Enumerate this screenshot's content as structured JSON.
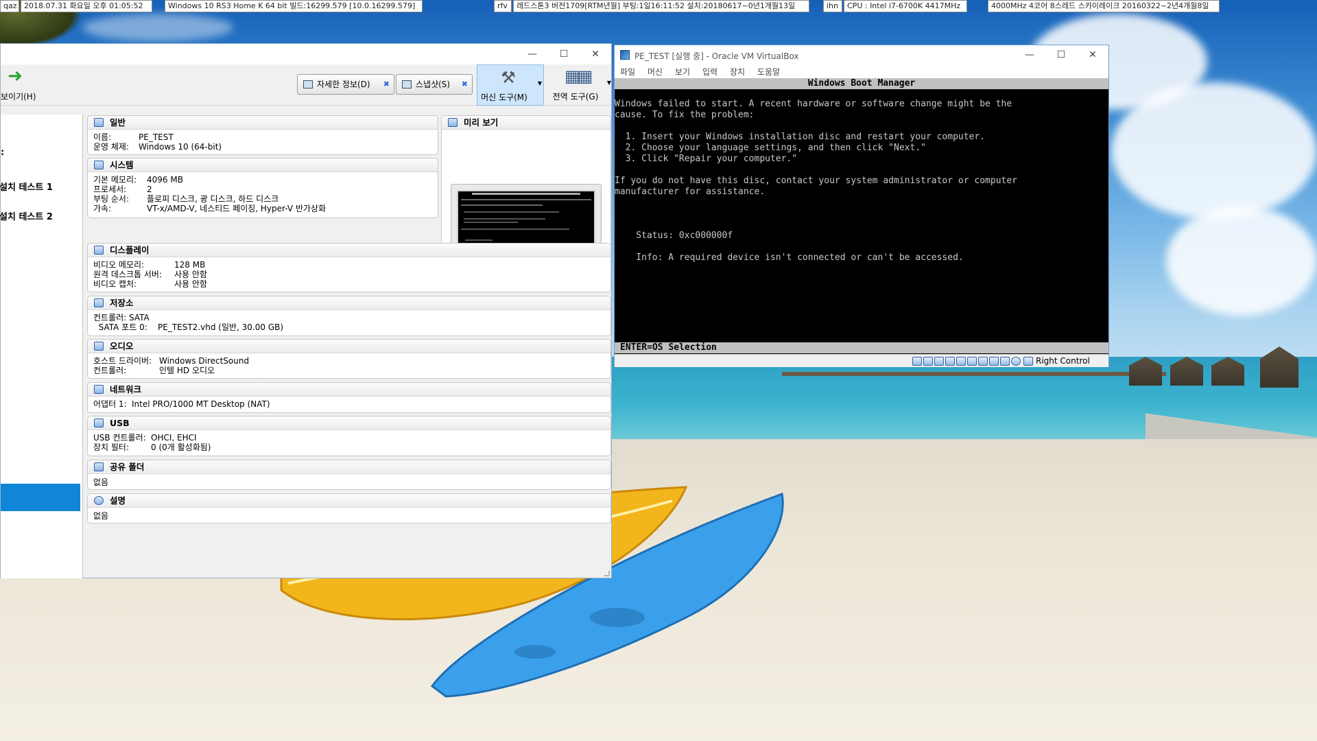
{
  "taskbar": {
    "items": [
      {
        "label": "qaz"
      },
      {
        "label": "2018.07.31 화요일 오후 01:05:52"
      },
      {
        "label": "Windows 10 RS3 Home K 64 bit 빌드:16299.579 [10.0.16299.579]"
      },
      {
        "label": "rfv"
      },
      {
        "label": "레드스톤3 버전1709[RTM년월] 부팅:1일16:11:52 설치:20180617~0년1개월13일"
      },
      {
        "label": "ihn"
      },
      {
        "label": "CPU : Intel i7-6700K 4417MHz"
      },
      {
        "label": "4000MHz 4코어 8스레드 스카이레이크 20160322~2년4개월8일"
      }
    ]
  },
  "manager": {
    "toolbar": {
      "show_label": "보이기(H)",
      "details_label": "자세한 정보(D)",
      "snapshots_label": "스냅샷(S)",
      "machine_tools_label": "머신 도구(M)",
      "global_tools_label": "전역 도구(G)"
    },
    "sidebar": {
      "items": [
        {
          "label": "설치 테스트 1"
        },
        {
          "label": "설치 테스트 2"
        }
      ]
    },
    "sections": {
      "general": {
        "title": "일반",
        "rows": [
          {
            "key": "이름:",
            "value": "PE_TEST"
          },
          {
            "key": "운영 체제:",
            "value": "Windows 10 (64-bit)"
          }
        ]
      },
      "system": {
        "title": "시스템",
        "rows": [
          {
            "key": "기본 메모리:",
            "value": "4096 MB"
          },
          {
            "key": "프로세서:",
            "value": "2"
          },
          {
            "key": "부팅 순서:",
            "value": "플로피 디스크, 광 디스크, 하드 디스크"
          },
          {
            "key": "가속:",
            "value": "VT-x/AMD-V, 네스티드 페이징, Hyper-V 반가상화"
          }
        ]
      },
      "preview": {
        "title": "미리 보기"
      },
      "display": {
        "title": "디스플레이",
        "rows": [
          {
            "key": "비디오 메모리:",
            "value": "128 MB"
          },
          {
            "key": "원격 데스크톱 서버:",
            "value": "사용 안함"
          },
          {
            "key": "비디오 캡처:",
            "value": "사용 안함"
          }
        ]
      },
      "storage": {
        "title": "저장소",
        "rows": [
          {
            "key": "컨트롤러: SATA",
            "value": ""
          },
          {
            "key": "  SATA 포트 0:",
            "value": "PE_TEST2.vhd (일반, 30.00 GB)"
          }
        ]
      },
      "audio": {
        "title": "오디오",
        "rows": [
          {
            "key": "호스트 드라이버:",
            "value": "Windows DirectSound"
          },
          {
            "key": "컨트롤러:",
            "value": "인텔 HD 오디오"
          }
        ]
      },
      "network": {
        "title": "네트워크",
        "rows": [
          {
            "key": "어댑터 1:",
            "value": "Intel PRO/1000 MT Desktop (NAT)"
          }
        ]
      },
      "usb": {
        "title": "USB",
        "rows": [
          {
            "key": "USB 컨트롤러:",
            "value": "OHCI, EHCI"
          },
          {
            "key": "장치 필터:",
            "value": "0 (0개 활성화됨)"
          }
        ]
      },
      "shared": {
        "title": "공유 폴더",
        "rows": [
          {
            "key": "없음",
            "value": ""
          }
        ]
      },
      "description": {
        "title": "설명",
        "rows": [
          {
            "key": "없음",
            "value": ""
          }
        ]
      }
    }
  },
  "vbox": {
    "title": "PE_TEST [실행 중] - Oracle VM VirtualBox",
    "menu": [
      "파일",
      "머신",
      "보기",
      "입력",
      "장치",
      "도움말"
    ],
    "screen": {
      "header": "Windows Boot Manager",
      "lines": [
        "Windows failed to start. A recent hardware or software change might be the",
        "cause. To fix the problem:",
        "",
        "  1. Insert your Windows installation disc and restart your computer.",
        "  2. Choose your language settings, and then click \"Next.\"",
        "  3. Click \"Repair your computer.\"",
        "",
        "If you do not have this disc, contact your system administrator or computer",
        "manufacturer for assistance.",
        "",
        "",
        "",
        "    Status: 0xc000000f",
        "",
        "    Info: A required device isn't connected or can't be accessed."
      ],
      "footer": "ENTER=OS Selection"
    },
    "host_key": "Right Control"
  }
}
